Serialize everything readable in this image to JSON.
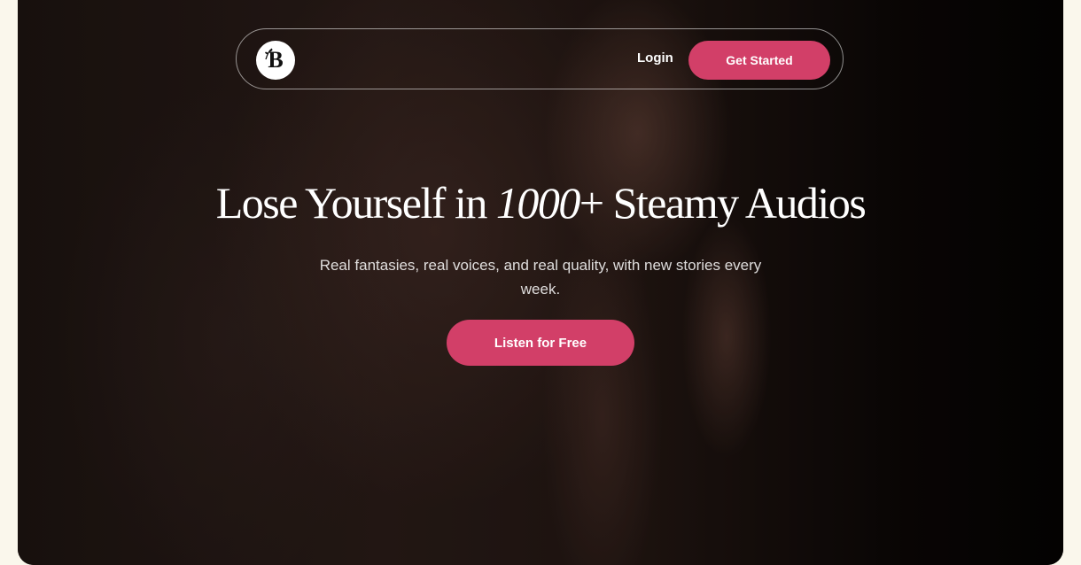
{
  "nav": {
    "logo_letter": "B",
    "login_label": "Login",
    "cta_label": "Get Started"
  },
  "hero": {
    "headline_before": "Lose Yourself in ",
    "headline_emphasis": "1000",
    "headline_after": "+ Steamy Audios",
    "subtitle": "Real fantasies, real voices, and real quality, with new stories every week.",
    "cta_label": "Listen for Free"
  },
  "colors": {
    "accent": "#d23f68",
    "page_background": "#faf7ec",
    "hero_background": "#120c0a",
    "text_light": "#ffffff"
  },
  "icons": {
    "logo": "sprig-b-logo-icon"
  }
}
